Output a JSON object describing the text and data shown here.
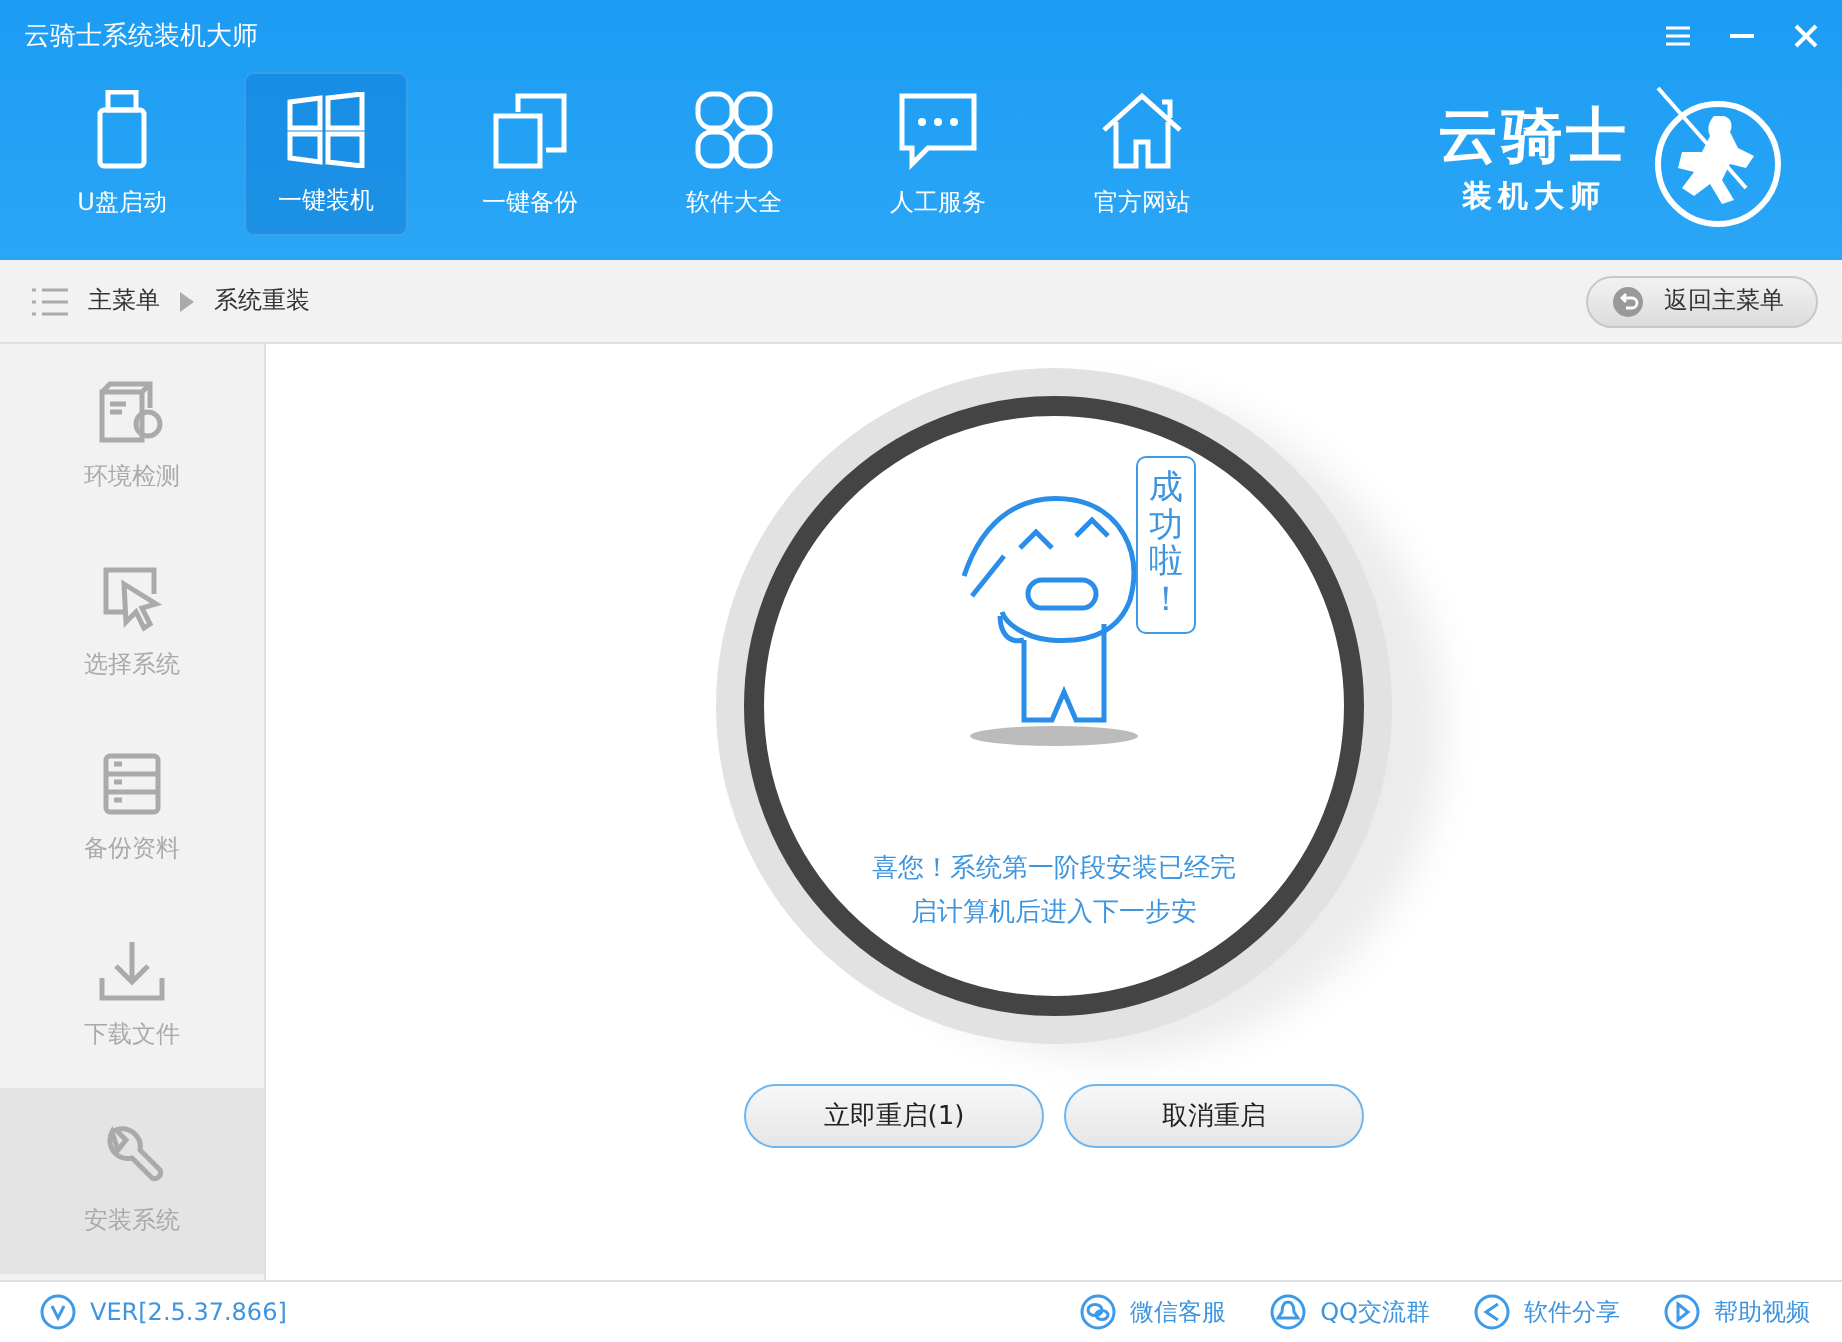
{
  "window": {
    "title": "云骑士系统装机大师"
  },
  "nav": [
    {
      "label": "U盘启动",
      "selected": false
    },
    {
      "label": "一键装机",
      "selected": true
    },
    {
      "label": "一键备份",
      "selected": false
    },
    {
      "label": "软件大全",
      "selected": false
    },
    {
      "label": "人工服务",
      "selected": false
    },
    {
      "label": "官方网站",
      "selected": false
    }
  ],
  "logo": {
    "name": "云骑士",
    "tagline": "装机大师"
  },
  "breadcrumb": [
    "主菜单",
    "系统重装"
  ],
  "back_button": "返回主菜单",
  "sidebar": [
    {
      "label": "环境检测",
      "selected": false
    },
    {
      "label": "选择系统",
      "selected": false
    },
    {
      "label": "备份资料",
      "selected": false
    },
    {
      "label": "下载文件",
      "selected": false
    },
    {
      "label": "安装系统",
      "selected": true
    }
  ],
  "bubble": "成功啦！",
  "message": [
    "喜您！系统第一阶段安装已经完",
    "启计算机后进入下一步安"
  ],
  "buttons": [
    "立即重启(1)",
    "取消重启"
  ],
  "footer": {
    "version": "VER[2.5.37.866]",
    "links": [
      "微信客服",
      "QQ交流群",
      "软件分享",
      "帮助视频"
    ]
  }
}
